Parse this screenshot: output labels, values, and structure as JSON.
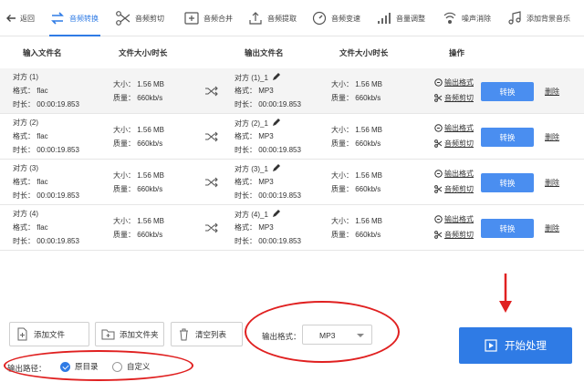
{
  "toolbar": {
    "back_label": "返回",
    "tabs": [
      {
        "label": "音频转换",
        "active": true
      },
      {
        "label": "音频剪切"
      },
      {
        "label": "音频合并"
      },
      {
        "label": "音频提取"
      },
      {
        "label": "音频变速"
      },
      {
        "label": "音量调整"
      },
      {
        "label": "噪声消除"
      },
      {
        "label": "添加背景音乐"
      }
    ]
  },
  "table": {
    "headers": {
      "input_file": "输入文件名",
      "input_size": "文件大小/时长",
      "output_file": "输出文件名",
      "output_size": "文件大小/时长",
      "actions": "操作"
    },
    "rows": [
      {
        "input_name": "对方 (1)",
        "input_format": "格式：  flac",
        "input_duration": "时长：  00:00:19.853",
        "input_size": "大小：  1.56 MB",
        "input_quality": "质量：  660kb/s",
        "output_name": "对方 (1)_1",
        "output_format": "格式：  MP3",
        "output_duration": "时长：  00:00:19.853",
        "output_size": "大小：  1.56 MB",
        "output_quality": "质量：  660kb/s",
        "op_format": "输出格式",
        "op_cut": "音频剪切",
        "convert": "转换",
        "delete": "删除"
      },
      {
        "input_name": "对方 (2)",
        "input_format": "格式：  flac",
        "input_duration": "时长：  00:00:19.853",
        "input_size": "大小：  1.56 MB",
        "input_quality": "质量：  660kb/s",
        "output_name": "对方 (2)_1",
        "output_format": "格式：  MP3",
        "output_duration": "时长：  00:00:19.853",
        "output_size": "大小：  1.56 MB",
        "output_quality": "质量：  660kb/s",
        "op_format": "输出格式",
        "op_cut": "音频剪切",
        "convert": "转换",
        "delete": "删除"
      },
      {
        "input_name": "对方 (3)",
        "input_format": "格式：  flac",
        "input_duration": "时长：  00:00:19.853",
        "input_size": "大小：  1.56 MB",
        "input_quality": "质量：  660kb/s",
        "output_name": "对方 (3)_1",
        "output_format": "格式：  MP3",
        "output_duration": "时长：  00:00:19.853",
        "output_size": "大小：  1.56 MB",
        "output_quality": "质量：  660kb/s",
        "op_format": "输出格式",
        "op_cut": "音频剪切",
        "convert": "转换",
        "delete": "删除"
      },
      {
        "input_name": "对方 (4)",
        "input_format": "格式：  flac",
        "input_duration": "时长：  00:00:19.853",
        "input_size": "大小：  1.56 MB",
        "input_quality": "质量：  660kb/s",
        "output_name": "对方 (4)_1",
        "output_format": "格式：  MP3",
        "output_duration": "时长：  00:00:19.853",
        "output_size": "大小：  1.56 MB",
        "output_quality": "质量：  660kb/s",
        "op_format": "输出格式",
        "op_cut": "音频剪切",
        "convert": "转换",
        "delete": "删除"
      }
    ]
  },
  "bottom": {
    "add_file": "添加文件",
    "add_folder": "添加文件夹",
    "clear_list": "清空列表",
    "output_format_label": "输出格式：",
    "output_format_value": "MP3",
    "start": "开始处理",
    "output_path_label": "输出路径：",
    "path_options": [
      {
        "label": "原目录",
        "checked": true
      },
      {
        "label": "自定义",
        "checked": false
      }
    ]
  },
  "colors": {
    "accent": "#2f7be5",
    "button": "#4a8ef0",
    "annotation": "#e02020"
  },
  "icons": {
    "back": "arrow-left-icon",
    "tabs": [
      "convert-icon",
      "scissors-icon",
      "merge-icon",
      "extract-icon",
      "speed-icon",
      "volume-icon",
      "denoise-icon",
      "music-icon"
    ],
    "row": [
      "shuffle-icon",
      "pencil-icon",
      "format-icon",
      "scissors-icon"
    ],
    "bottom": [
      "add-file-icon",
      "add-folder-icon",
      "trash-icon",
      "play-icon"
    ]
  }
}
